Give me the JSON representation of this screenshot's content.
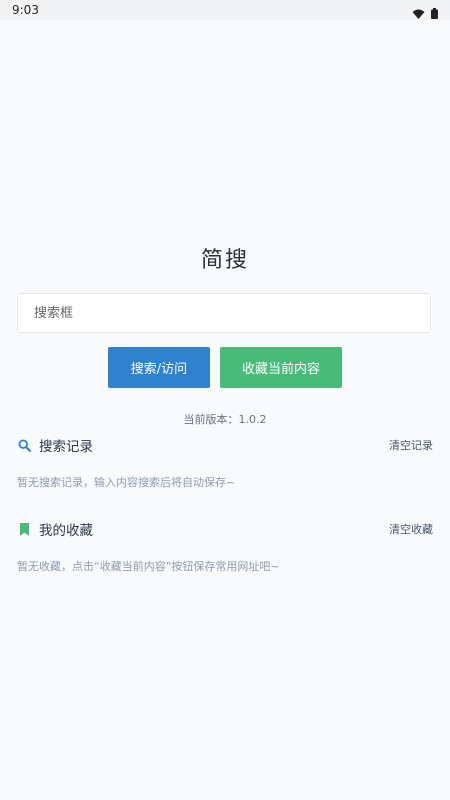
{
  "status_bar": {
    "time": "9:03"
  },
  "app": {
    "title": "简搜",
    "version_text": "当前版本：1.0.2"
  },
  "search": {
    "placeholder": "搜索框",
    "value": ""
  },
  "buttons": {
    "search_label": "搜索/访问",
    "favorite_label": "收藏当前内容"
  },
  "history": {
    "title": "搜索记录",
    "clear_label": "清空记录",
    "empty_text": "暂无搜索记录，输入内容搜索后将自动保存~",
    "icon": "search-icon"
  },
  "favorites": {
    "title": "我的收藏",
    "clear_label": "清空收藏",
    "empty_text": "暂无收藏，点击“收藏当前内容”按钮保存常用网址吧~",
    "icon": "bookmark-icon"
  },
  "colors": {
    "primary": "#3182ce",
    "success": "#48bb78",
    "background": "#f8fafc"
  }
}
